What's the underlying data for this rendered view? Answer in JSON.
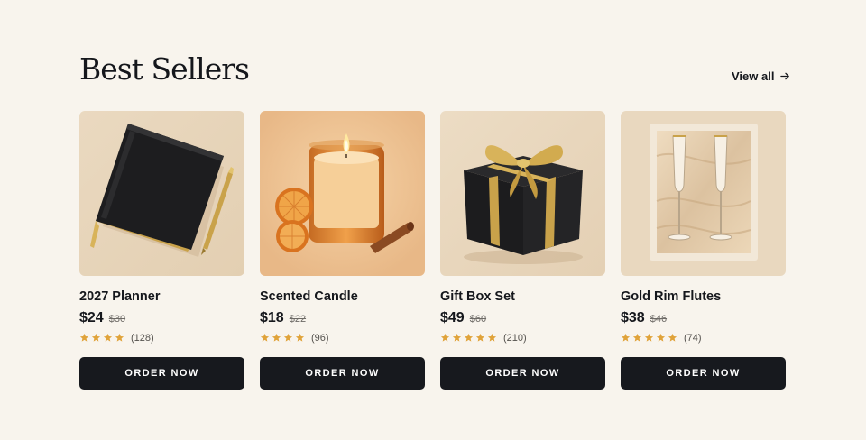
{
  "section": {
    "title": "Best Sellers",
    "view_all_label": "View all",
    "view_all_icon": "arrow-right-icon"
  },
  "colors": {
    "background": "#f8f4ed",
    "text": "#15171c",
    "button": "#17191e",
    "star": "#e0a33a"
  },
  "products": [
    {
      "name": "2027 Planner",
      "price": "$24",
      "old_price": "$30",
      "rating": 4,
      "rating_count": "(128)",
      "button_label": "ORDER NOW",
      "image_icon": "planner-image"
    },
    {
      "name": "Scented Candle",
      "price": "$18",
      "old_price": "$22",
      "rating": 4,
      "rating_count": "(96)",
      "button_label": "ORDER NOW",
      "image_icon": "candle-image"
    },
    {
      "name": "Gift Box Set",
      "price": "$49",
      "old_price": "$60",
      "rating": 5,
      "rating_count": "(210)",
      "button_label": "ORDER NOW",
      "image_icon": "gift-box-image"
    },
    {
      "name": "Gold Rim Flutes",
      "price": "$38",
      "old_price": "$46",
      "rating": 5,
      "rating_count": "(74)",
      "button_label": "ORDER NOW",
      "image_icon": "champagne-flutes-image"
    }
  ]
}
